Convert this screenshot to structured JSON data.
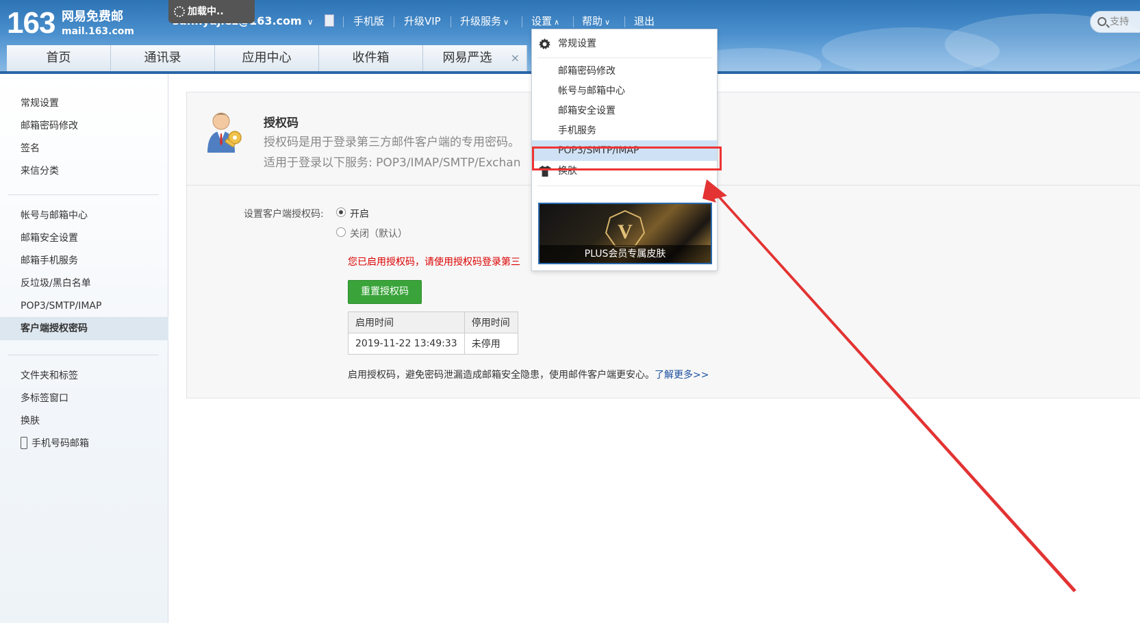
{
  "header": {
    "logo_number": "163",
    "logo_name": "网易免费邮",
    "logo_url": "mail.163.com",
    "loading_text": "加载中..",
    "account": "sunnyajiez@163.com",
    "nav": [
      "手机版",
      "升级VIP",
      "升级服务",
      "设置",
      "帮助",
      "退出"
    ],
    "search_placeholder": "支持"
  },
  "tabs": [
    {
      "label": "首页"
    },
    {
      "label": "通讯录"
    },
    {
      "label": "应用中心"
    },
    {
      "label": "收件箱"
    },
    {
      "label": "网易严选",
      "close": "×"
    }
  ],
  "sidebar": {
    "groups": [
      [
        "常规设置",
        "邮箱密码修改",
        "签名",
        "来信分类"
      ],
      [
        "帐号与邮箱中心",
        "邮箱安全设置",
        "邮箱手机服务",
        "反垃圾/黑白名单",
        "POP3/SMTP/IMAP",
        "客户端授权密码"
      ],
      [
        "文件夹和标签",
        "多标签窗口",
        "换肤",
        "手机号码邮箱"
      ]
    ],
    "active": "客户端授权密码"
  },
  "auth": {
    "title": "授权码",
    "desc1": "授权码是用于登录第三方邮件客户端的专用密码。",
    "desc2": "适用于登录以下服务: POP3/IMAP/SMTP/Exchan",
    "setting_label": "设置客户端授权码:",
    "option_on": "开启",
    "option_off": "关闭（默认）",
    "selected": "开启",
    "enabled_msg": "您已启用授权码，请使用授权码登录第三",
    "reset_button": "重置授权码",
    "table_headers": [
      "启用时间",
      "停用时间"
    ],
    "table_rows": [
      [
        "2019-11-22 13:49:33",
        "未停用"
      ]
    ],
    "footnote": "启用授权码，避免密码泄漏造成邮箱安全隐患，使用邮件客户端更安心。",
    "learn_more": "了解更多>>"
  },
  "dropdown": {
    "general": "常规设置",
    "items": [
      "邮箱密码修改",
      "帐号与邮箱中心",
      "邮箱安全设置",
      "手机服务",
      "POP3/SMTP/IMAP"
    ],
    "highlighted": "POP3/SMTP/IMAP",
    "skin": "换肤",
    "promo_label": "PLUS会员专属皮肤",
    "promo_letter": "V"
  },
  "colors": {
    "header_blue": "#2d74b5",
    "annotation_red": "#e33333",
    "highlight": "#cfe2f5",
    "button_green": "#3aa43a",
    "error_red": "#dd0000",
    "link_blue": "#1a4fa0"
  }
}
